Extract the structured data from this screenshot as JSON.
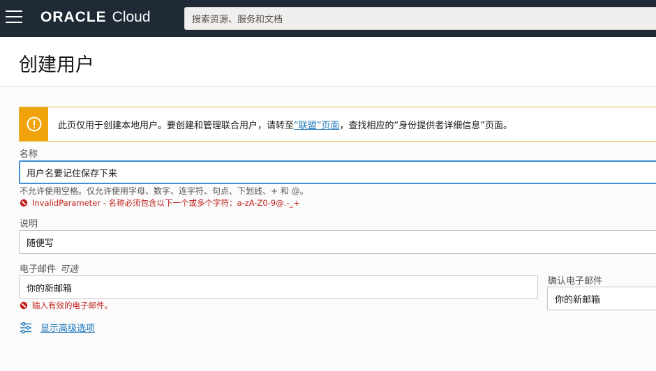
{
  "header": {
    "logo_brand": "ORACLE",
    "logo_product": "Cloud",
    "search_placeholder": "搜索资源、服务和文档"
  },
  "page": {
    "title": "创建用户"
  },
  "banner": {
    "text_before": "此页仅用于创建本地用户。要创建和管理联合用户，请转至",
    "link": "“联盟”页面",
    "text_after": "，查找相应的“身份提供者详细信息”页面。"
  },
  "form": {
    "name": {
      "label": "名称",
      "value": "用户名要记住保存下来",
      "hint": "不允许使用空格。仅允许使用字母、数字、连字符、句点、下划线、+ 和 @。",
      "error": "InvalidParameter - 名称必须包含以下一个或多个字符：a-zA-Z0-9@.-_+"
    },
    "description": {
      "label": "说明",
      "value": "随便写"
    },
    "email": {
      "label": "电子邮件",
      "optional": "可选",
      "value": "你的新邮箱",
      "error": "输入有效的电子邮件。"
    },
    "confirm_email": {
      "label": "确认电子邮件",
      "value": "你的新邮箱"
    },
    "advanced_link": "显示高级选项"
  },
  "colors": {
    "topbar": "#1f2a36",
    "warning": "#f0a30a",
    "error": "#c0201b",
    "link": "#1a74b8"
  }
}
